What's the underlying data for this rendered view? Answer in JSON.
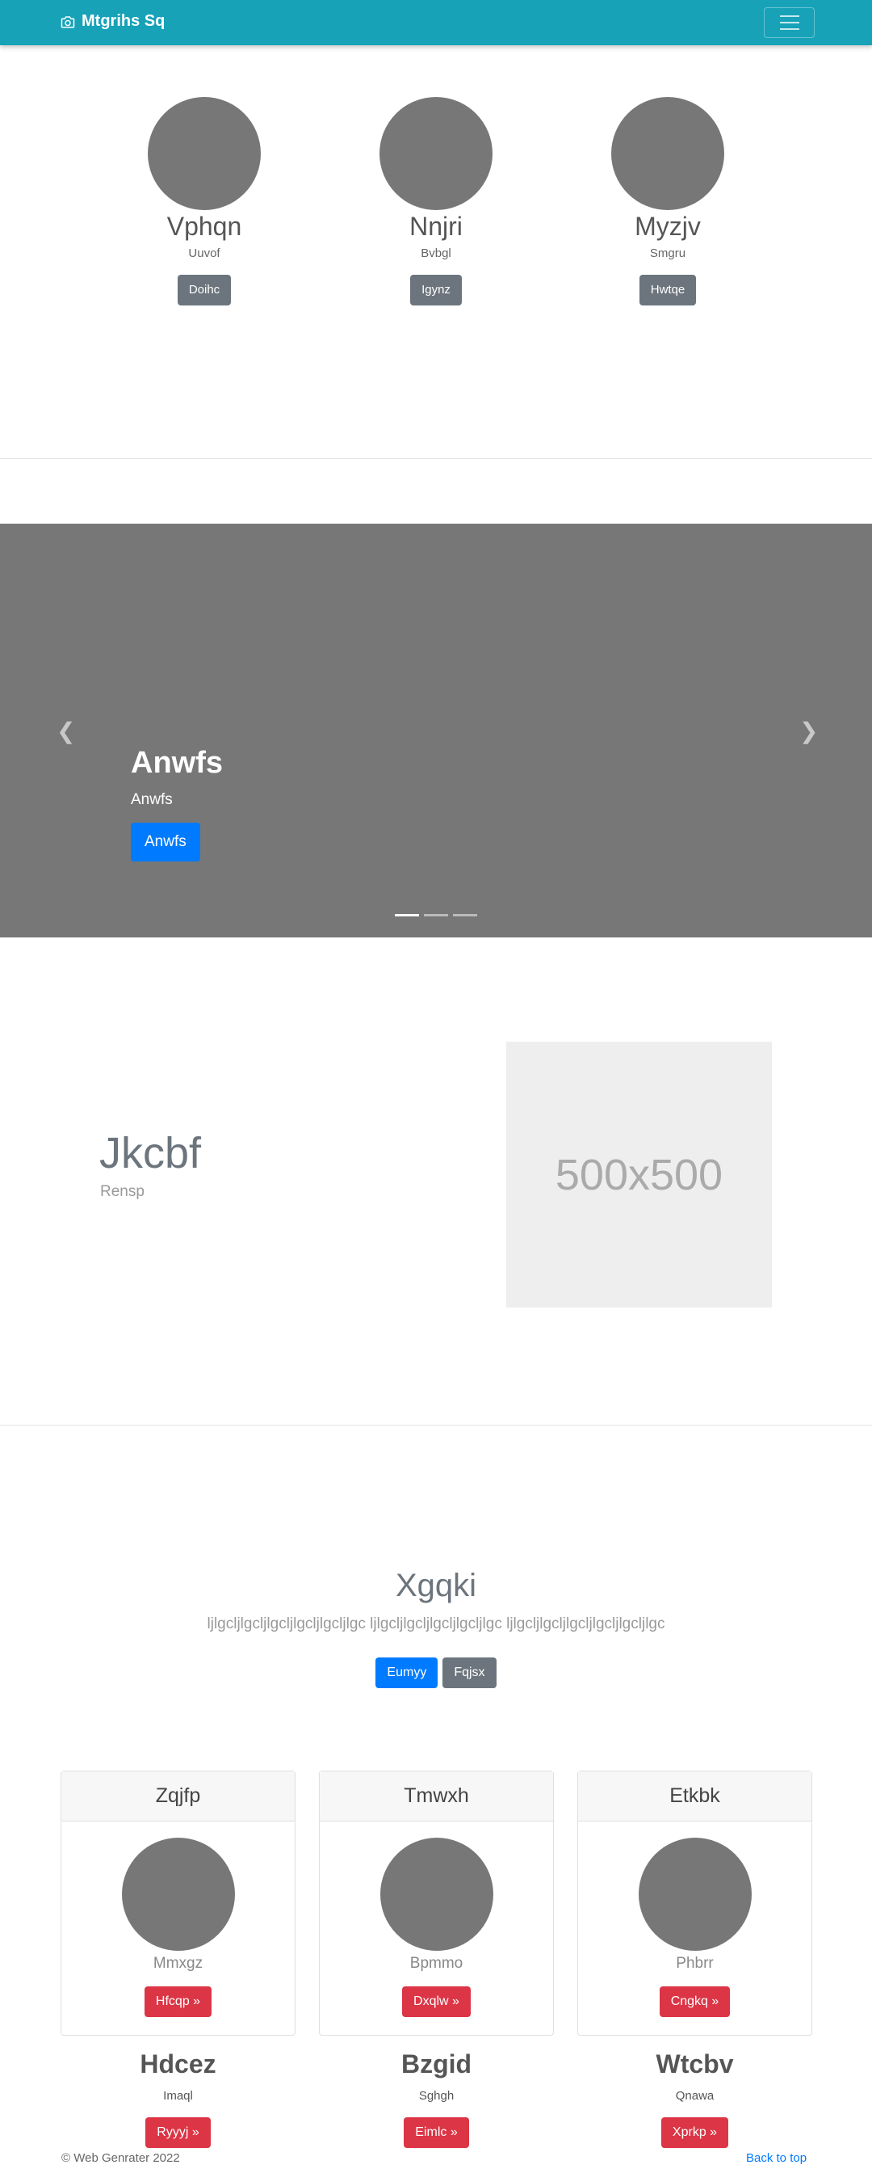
{
  "navbar": {
    "brand": "Mtgrihs Sq",
    "brand_icon": "camera-icon",
    "toggler_icon": "hamburger-menu-icon"
  },
  "team": [
    {
      "name": "Vphqn",
      "role": "Uuvof",
      "button": "Doihc"
    },
    {
      "name": "Nnjri",
      "role": "Bvbgl",
      "button": "Igynz"
    },
    {
      "name": "Myzjv",
      "role": "Smgru",
      "button": "Hwtqe"
    }
  ],
  "carousel": {
    "title": "Anwfs",
    "text": "Anwfs",
    "button": "Anwfs",
    "prev_icon": "chevron-left-icon",
    "next_icon": "chevron-right-icon",
    "slides": 3,
    "active_slide": 1
  },
  "featurette": {
    "heading": "Jkcbf",
    "lead": "Rensp",
    "image_label": "500x500"
  },
  "pricing": {
    "title": "Xgqki",
    "text": "ljlgcljlgcljlgcljlgcljlgcljlgc ljlgcljlgcljlgcljlgcljlgc ljlgcljlgcljlgcljlgcljlgcljlgc",
    "buttons": [
      "Eumyy",
      "Fqjsx"
    ]
  },
  "cards": [
    {
      "header": "Zqjfp",
      "sub": "Mmxgz",
      "button": "Hfcqp »"
    },
    {
      "header": "Tmwxh",
      "sub": "Bpmmo",
      "button": "Dxqlw »"
    },
    {
      "header": "Etkbk",
      "sub": "Phbrr",
      "button": "Cngkq »"
    }
  ],
  "columns": [
    {
      "title": "Hdcez",
      "sub": "Imaql",
      "button": "Ryyyj »"
    },
    {
      "title": "Bzgid",
      "sub": "Sghgh",
      "button": "Eimlc »"
    },
    {
      "title": "Wtcbv",
      "sub": "Qnawa",
      "button": "Xprkp »"
    }
  ],
  "footer": {
    "copyright": "© Web Genrater 2022",
    "back_to_top": "Back to top"
  },
  "colors": {
    "navbar": "#17a2b8",
    "primary": "#007bff",
    "secondary": "#6c757d",
    "danger": "#dc3545",
    "placeholder_dark": "#777777"
  }
}
